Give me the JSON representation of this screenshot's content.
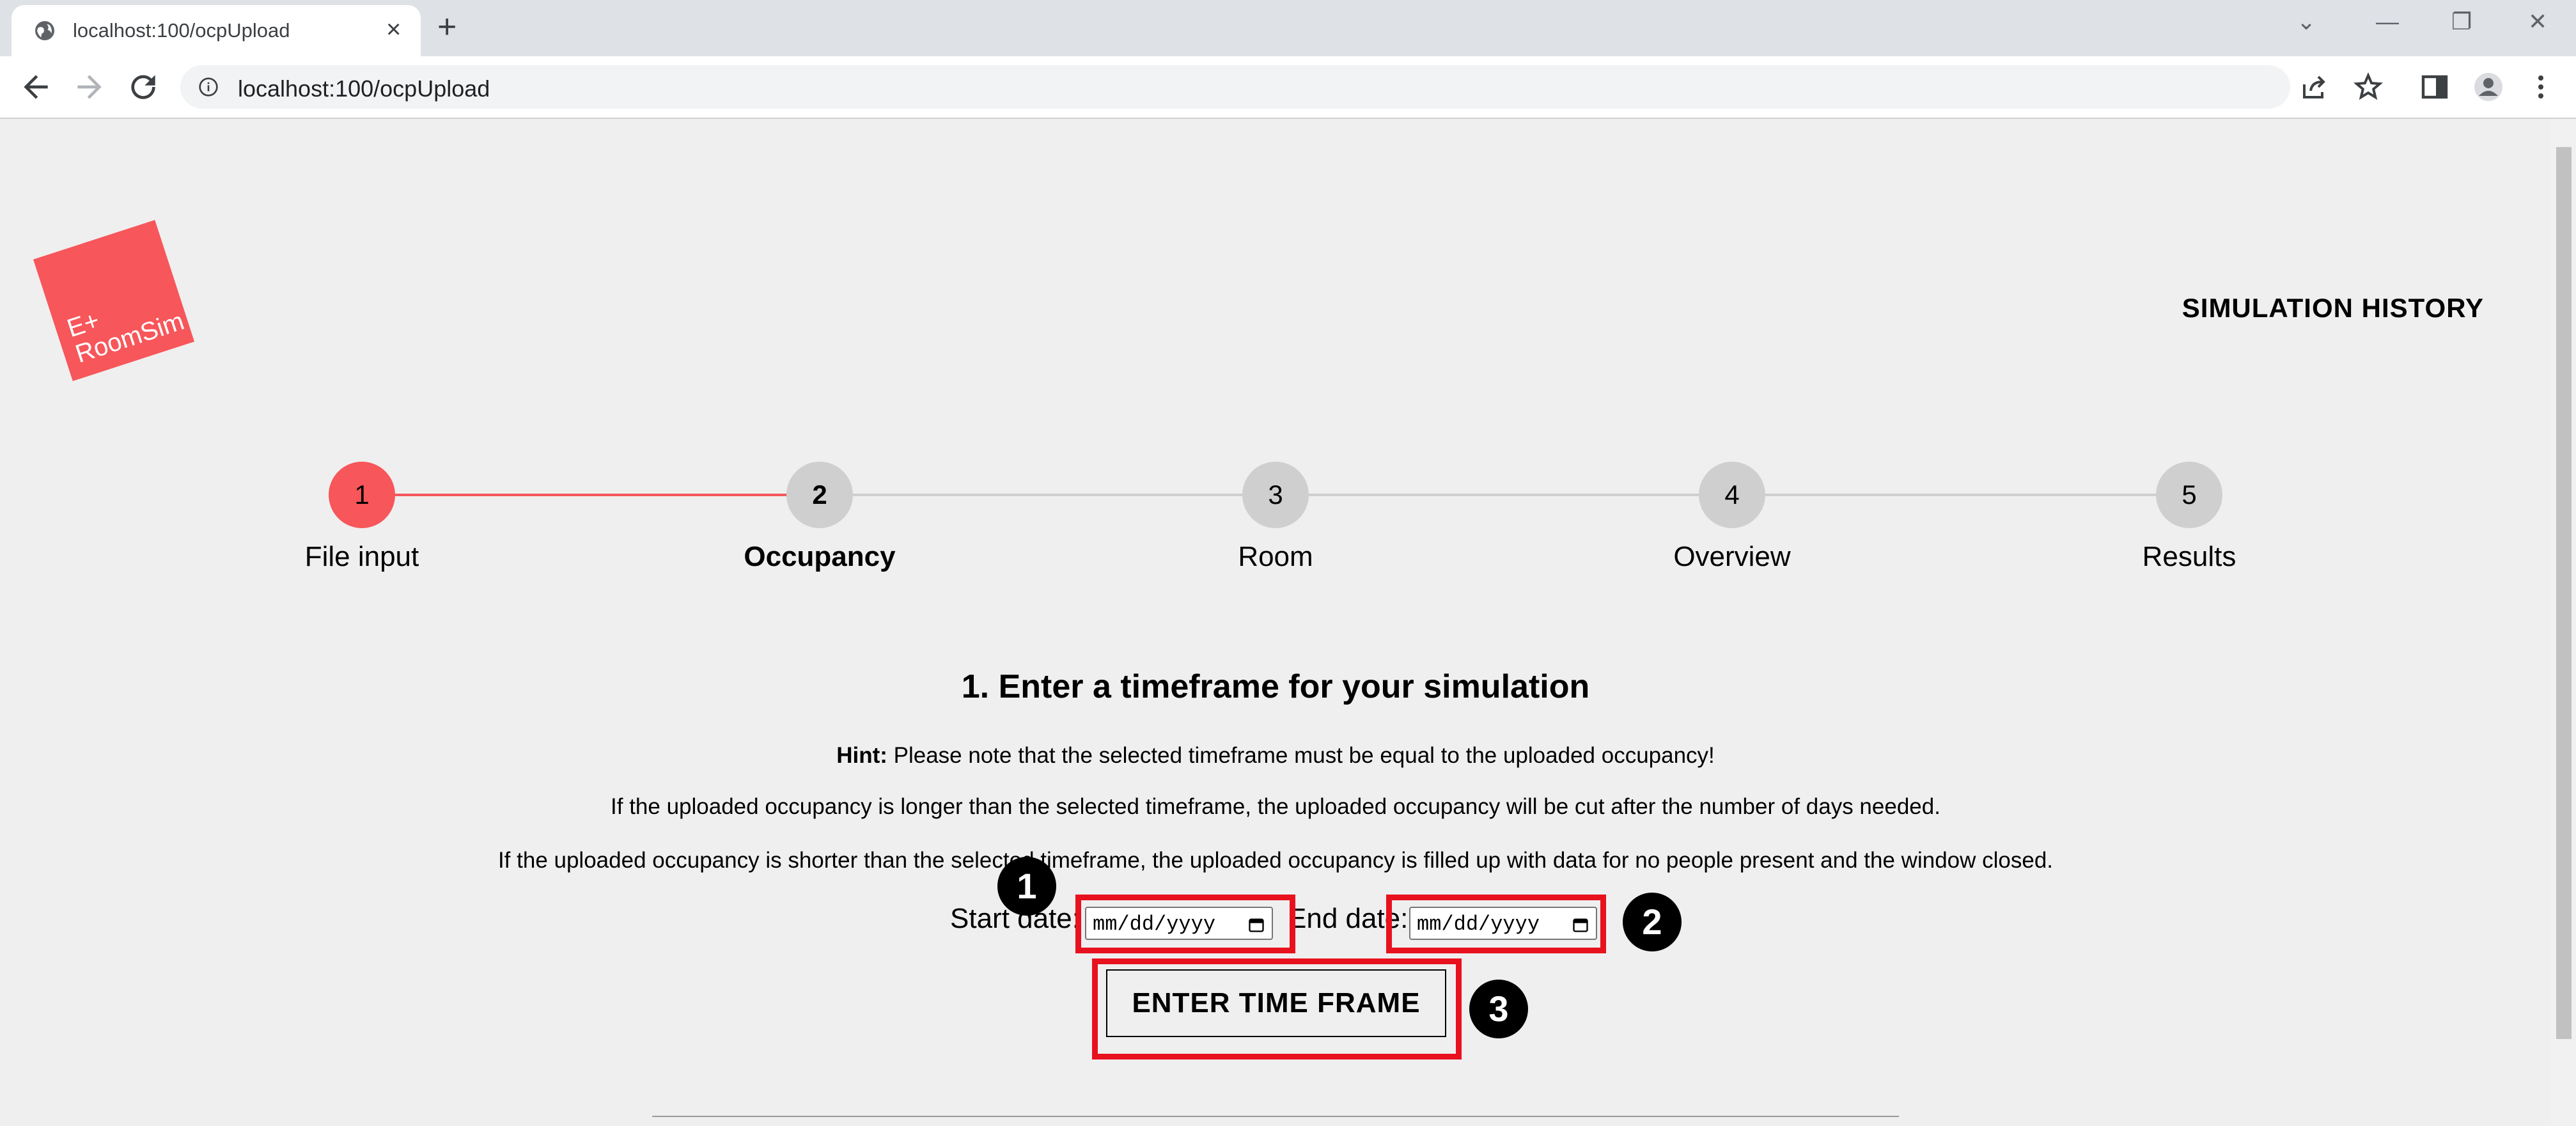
{
  "browser": {
    "tab_title": "localhost:100/ocpUpload",
    "url": "localhost:100/ocpUpload"
  },
  "header": {
    "logo_line1": "E+",
    "logo_line2": "RoomSim",
    "simulation_history": "SIMULATION HISTORY"
  },
  "stepper": {
    "steps": [
      {
        "number": "1",
        "label": "File input"
      },
      {
        "number": "2",
        "label": "Occupancy"
      },
      {
        "number": "3",
        "label": "Room"
      },
      {
        "number": "4",
        "label": "Overview"
      },
      {
        "number": "5",
        "label": "Results"
      }
    ],
    "active_color": "#f7565a",
    "inactive_color": "#cfcfcf"
  },
  "timeframe": {
    "heading": "1. Enter a timeframe for your simulation",
    "hint_label": "Hint:",
    "hint_text": " Please note that the selected timeframe must be equal to the uploaded occupancy!",
    "note_longer": "If the uploaded occupancy is longer than the selected timeframe, the uploaded occupancy will be cut after the number of days needed.",
    "note_shorter": "If the uploaded occupancy is shorter than the selected timeframe, the uploaded occupancy is filled up with data for no people present and the window closed.",
    "start_label": "Start date:",
    "start_placeholder": "mm/dd/yyyy",
    "end_label": "End date:",
    "end_placeholder": "mm/dd/yyyy",
    "button_label": "ENTER TIME FRAME"
  },
  "annotations": {
    "badge1": "1",
    "badge2": "2",
    "badge3": "3",
    "color": "#e8111e"
  }
}
